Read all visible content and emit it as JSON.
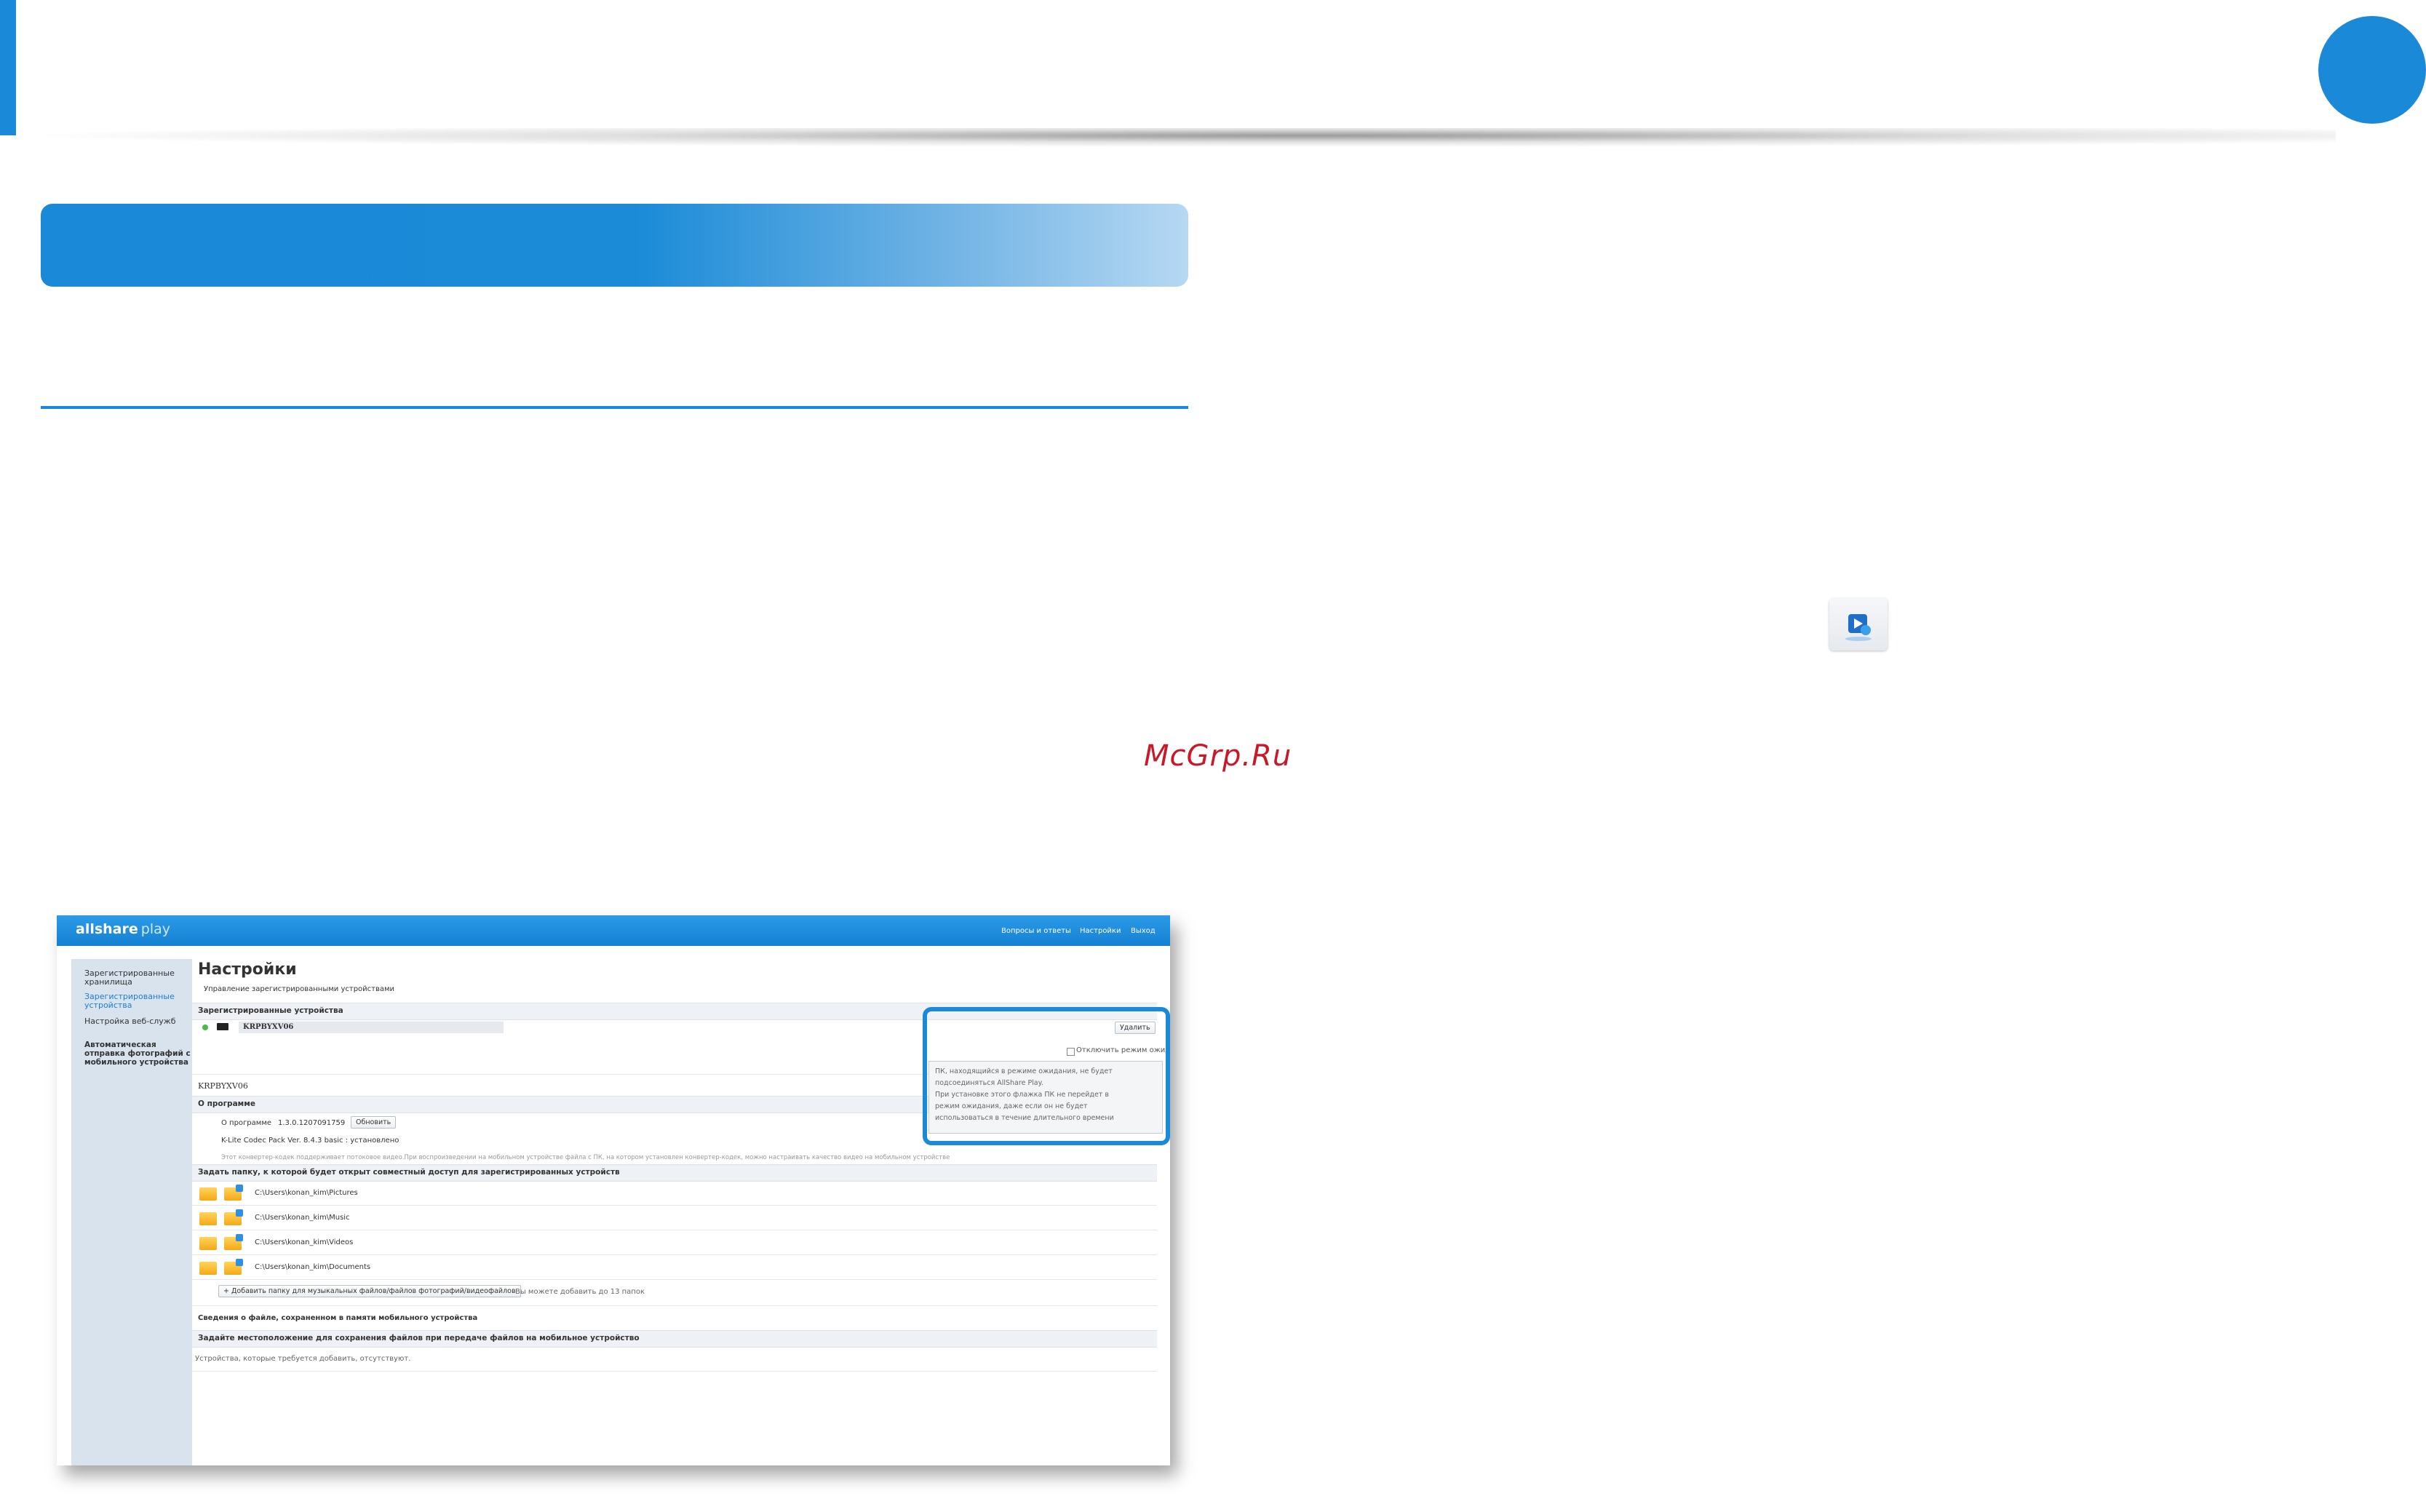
{
  "watermark": "McGrp.Ru",
  "app_icon": "allshare-play-app-icon",
  "screenshot": {
    "logo": {
      "main": "allshare",
      "sub": "play"
    },
    "top_nav": [
      "Вопросы и ответы",
      "Настройки",
      "Выход"
    ],
    "sidebar": [
      {
        "label": "Зарегистрированные хранилища",
        "active": false
      },
      {
        "label": "Зарегистрированные устройства",
        "active": true
      },
      {
        "label": "Настройка веб-служб",
        "active": false
      },
      {
        "label": "Автоматическая отправка фотографий с мобильного устройства",
        "active": false
      }
    ],
    "page_title": "Настройки",
    "page_subtitle": "Управление зарегистрированными устройствами",
    "registered_header": "Зарегистрированные устройства",
    "device_name": "KRPBYXV06",
    "delete_button": "Удалить",
    "standby_checkbox": "Отключить режим ожидания ПК",
    "standby_tooltip": [
      "ПК, находящийся в режиме ожидания, не будет",
      "подсоединяться AllShare Play.",
      "При установке этого флажка ПК не перейдет в",
      "режим ожидания, даже если он не будет",
      "использоваться в течение длительного времени"
    ],
    "device_label": "KRPBYXV06",
    "about_header": "О программе",
    "about_label": "О программе",
    "version": "1.3.0.1207091759",
    "update_button": "Обновить",
    "codec": "K-Lite Codec Pack Ver. 8.4.3 basic : установлено",
    "codec_note": "Этот конвертер-кодек поддерживает потоковое видео.При воспроизведении на мобильном устройстве файла с ПК, на котором установлен конвертер-кодек, можно настраивать качество видео на мобильном устройстве",
    "folders_header": "Задать папку, к которой будет открыт совместный доступ для зарегистрированных устройств",
    "folders": [
      "C:\\Users\\konan_kim\\Pictures",
      "C:\\Users\\konan_kim\\Music",
      "C:\\Users\\konan_kim\\Videos",
      "C:\\Users\\konan_kim\\Documents"
    ],
    "add_folder_button": "+ Добавить папку для музыкальных файлов/файлов фотографий/видеофайлов",
    "add_folder_note": "Вы можете добавить до 13 папок",
    "mobile_info_header": "Сведения о файле, сохраненном в памяти мобильного устройства",
    "save_location_header": "Задайте местоположение для сохранения файлов при передаче файлов на мобильное устройство",
    "no_devices": "Устройства, которые требуется добавить, отсутствуют."
  },
  "colors": {
    "accent": "#1a8ad8",
    "watermark": "#c8182a",
    "sidebar": "#d8e3ee"
  }
}
